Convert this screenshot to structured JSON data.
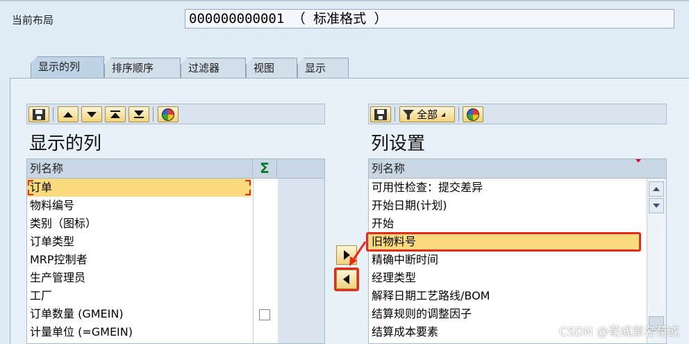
{
  "header": {
    "layout_label": "当前布局",
    "layout_value": "000000000001 （ 标准格式 ）"
  },
  "tabs": [
    {
      "label": "显示的列"
    },
    {
      "label": "排序顺序"
    },
    {
      "label": "过滤器"
    },
    {
      "label": "视图"
    },
    {
      "label": "显示"
    }
  ],
  "left": {
    "title": "显示的列",
    "column_header": "列名称",
    "sum_symbol": "Σ",
    "rows": [
      "订单",
      "物料编号",
      "类别（图标）",
      "订单类型",
      "MRP控制者",
      "生产管理员",
      "工厂",
      "订单数量 (GMEIN)",
      "计量单位 (=GMEIN)"
    ]
  },
  "right": {
    "title": "列设置",
    "column_header": "列名称",
    "filter_label": "全部",
    "rows": [
      "可用性检查：提交差异",
      "开始日期(计划)",
      "开始",
      "旧物料号",
      "精确中断时间",
      "经理类型",
      "解释日期工艺路线/BOM",
      "结算规则的调整因子",
      "结算成本要素"
    ]
  },
  "watermark": "CSDN @荀彧原名荀或",
  "colors": {
    "selection": "#fbdb7e",
    "highlight": "#e8291c",
    "background": "#dfebf5"
  }
}
